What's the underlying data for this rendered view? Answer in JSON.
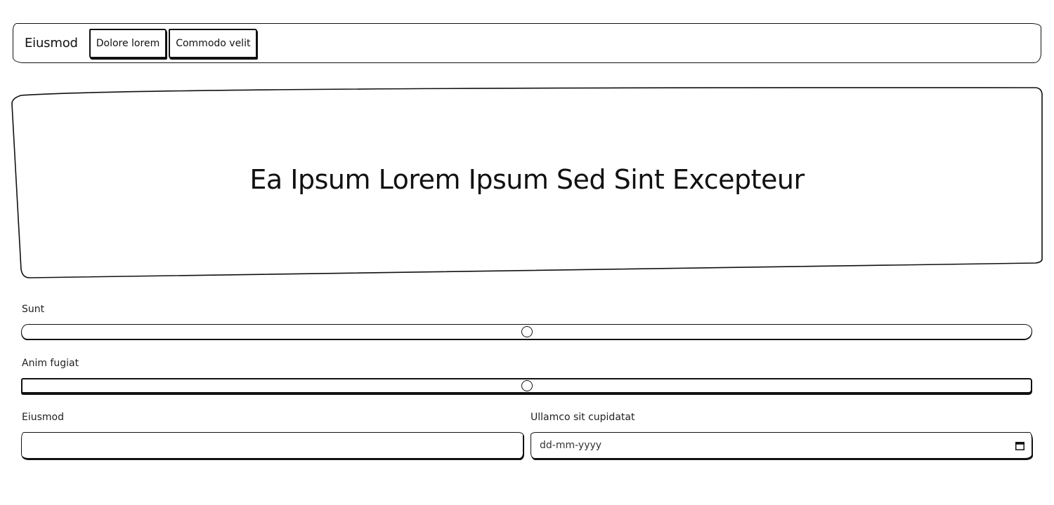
{
  "nav": {
    "brand": "Eiusmod",
    "buttons": [
      "Dolore lorem",
      "Commodo velit"
    ]
  },
  "hero": {
    "title": "Ea Ipsum Lorem Ipsum Sed Sint Excepteur"
  },
  "form": {
    "slider1": {
      "label": "Sunt",
      "value_fraction": 0.5
    },
    "slider2": {
      "label": "Anim fugiat",
      "value_fraction": 0.5
    },
    "text_field": {
      "label": "Eiusmod",
      "value": "",
      "placeholder": ""
    },
    "date_field": {
      "label": "Ullamco sit cupidatat",
      "placeholder": "dd-mm-yyyy"
    }
  }
}
